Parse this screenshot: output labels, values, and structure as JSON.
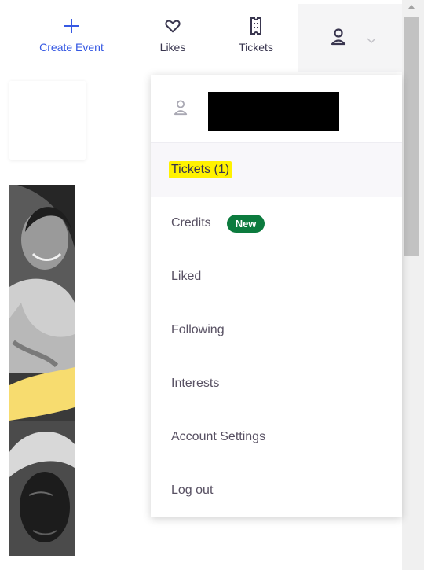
{
  "header": {
    "nav": [
      {
        "label": "Create Event",
        "icon": "plus-icon"
      },
      {
        "label": "Likes",
        "icon": "heart-icon"
      },
      {
        "label": "Tickets",
        "icon": "ticket-icon"
      }
    ],
    "account_icon": "user-icon",
    "chevron_icon": "chevron-down-icon"
  },
  "menu": {
    "profile_icon": "user-icon",
    "items": [
      {
        "label": "Tickets (1)",
        "highlighted": true
      },
      {
        "label": "Credits",
        "badge": "New"
      },
      {
        "label": "Liked"
      },
      {
        "label": "Following"
      },
      {
        "label": "Interests"
      },
      {
        "label": "Account Settings"
      },
      {
        "label": "Log out"
      }
    ]
  },
  "colors": {
    "accent_blue": "#3659e3",
    "badge_green": "#0c7b3e",
    "highlight_yellow": "#fff200",
    "promo_yellow": "#f7dc6f"
  }
}
